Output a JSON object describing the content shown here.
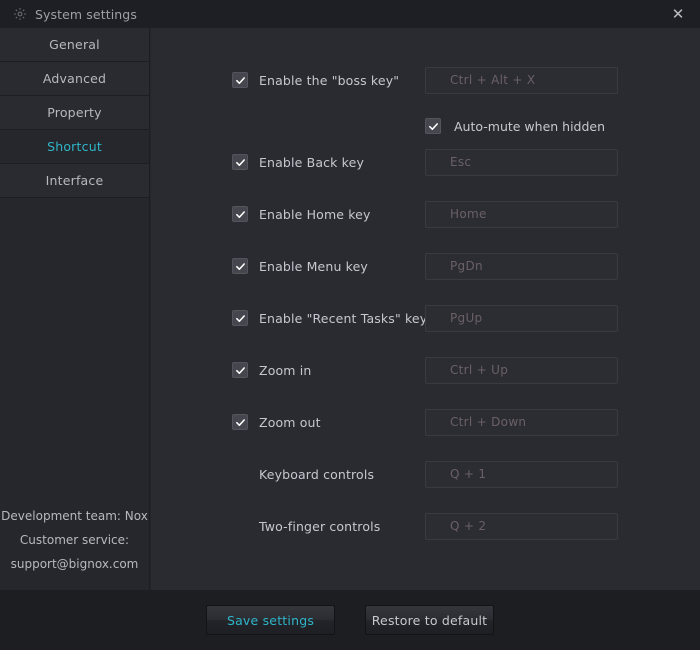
{
  "window": {
    "title": "System settings",
    "gear_icon": "gear-icon",
    "close_label": "✕"
  },
  "sidebar": {
    "items": [
      {
        "label": "General",
        "active": false
      },
      {
        "label": "Advanced",
        "active": false
      },
      {
        "label": "Property",
        "active": false
      },
      {
        "label": "Shortcut",
        "active": true
      },
      {
        "label": "Interface",
        "active": false
      }
    ],
    "footer": {
      "line1": "Development team: Nox",
      "line2": "Customer service:",
      "line3": "support@bignox.com"
    }
  },
  "main": {
    "rows": [
      {
        "label": "Enable the \"boss key\"",
        "checkbox": true,
        "checked": true,
        "value": "Ctrl + Alt + X"
      },
      {
        "label": "Enable Back key",
        "checkbox": true,
        "checked": true,
        "value": "Esc"
      },
      {
        "label": "Enable Home key",
        "checkbox": true,
        "checked": true,
        "value": "Home"
      },
      {
        "label": "Enable Menu key",
        "checkbox": true,
        "checked": true,
        "value": "PgDn"
      },
      {
        "label": "Enable \"Recent Tasks\" key",
        "checkbox": true,
        "checked": true,
        "value": "PgUp"
      },
      {
        "label": "Zoom in",
        "checkbox": true,
        "checked": true,
        "value": "Ctrl + Up"
      },
      {
        "label": "Zoom out",
        "checkbox": true,
        "checked": true,
        "value": "Ctrl + Down"
      },
      {
        "label": "Keyboard controls",
        "checkbox": false,
        "checked": false,
        "value": "Q + 1"
      },
      {
        "label": "Two-finger controls",
        "checkbox": false,
        "checked": false,
        "value": "Q + 2"
      }
    ],
    "submute": {
      "label": "Auto-mute when hidden",
      "checked": true
    }
  },
  "footer": {
    "save_label": "Save settings",
    "restore_label": "Restore to default"
  },
  "colors": {
    "accent": "#2fb5c9",
    "window_bg": "#25262b",
    "titlebar_bg": "#1e1f24",
    "content_bg": "#2a2b31",
    "sidebar_bg": "#26272c",
    "field_text": "#6a6066",
    "label_text": "#c6c8cf"
  }
}
